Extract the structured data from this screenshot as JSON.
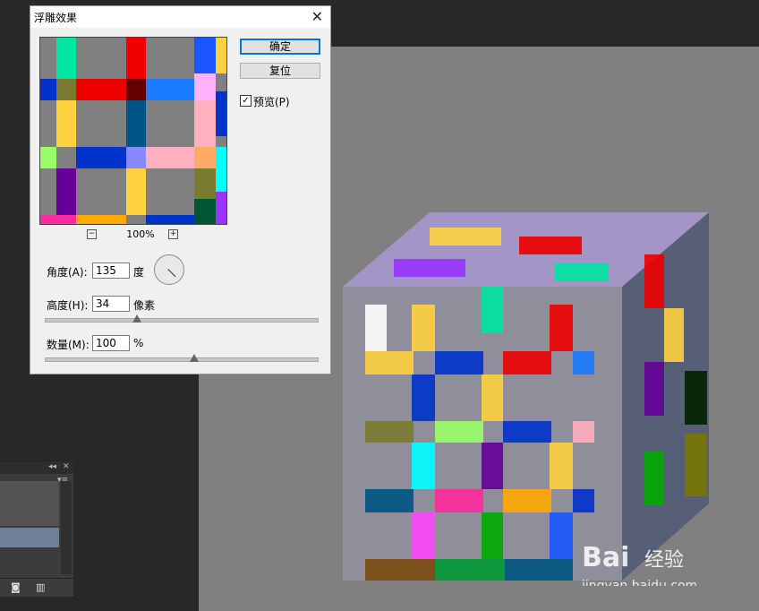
{
  "dialog": {
    "title": "浮雕效果",
    "ok_label": "确定",
    "reset_label": "复位",
    "preview_label": "预览(P)",
    "preview_checked": true,
    "zoom_level": "100%",
    "angle": {
      "label": "角度(A):",
      "value": "135",
      "unit": "度"
    },
    "height": {
      "label": "高度(H):",
      "value": "34",
      "unit": "像素",
      "slider_fraction": 0.34
    },
    "amount": {
      "label": "数量(M):",
      "value": "100",
      "unit": "%",
      "slider_fraction": 0.55
    }
  },
  "colors": {
    "canvas_bg": "#808080",
    "workspace_bg": "#282828",
    "accent": "#0078d7"
  },
  "watermark": "Baidu经验 jingyan.baidu.com"
}
